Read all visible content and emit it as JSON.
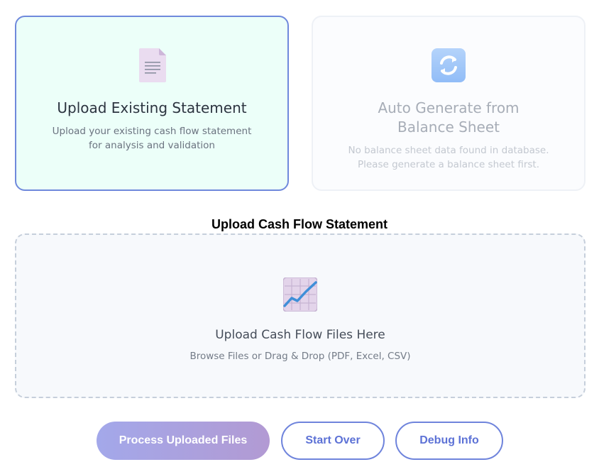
{
  "options": {
    "upload_existing": {
      "icon": "document-icon",
      "title": "Upload Existing Statement",
      "description": "Upload your existing cash flow statement for analysis and validation"
    },
    "auto_generate": {
      "icon": "sync-icon",
      "title": "Auto Generate from Balance Sheet",
      "description": "No balance sheet data found in database. Please generate a balance sheet first."
    }
  },
  "upload_section": {
    "heading": "Upload Cash Flow Statement",
    "dropzone": {
      "icon": "chart-increasing-icon",
      "title": "Upload Cash Flow Files Here",
      "subtitle": "Browse Files or Drag & Drop (PDF, Excel, CSV)"
    }
  },
  "actions": {
    "process_label": "Process Uploaded Files",
    "start_over_label": "Start Over",
    "debug_label": "Debug Info"
  },
  "colors": {
    "selected_border": "#6f89dc",
    "selected_background": "#ecfff9",
    "accent": "#5d72d6"
  }
}
